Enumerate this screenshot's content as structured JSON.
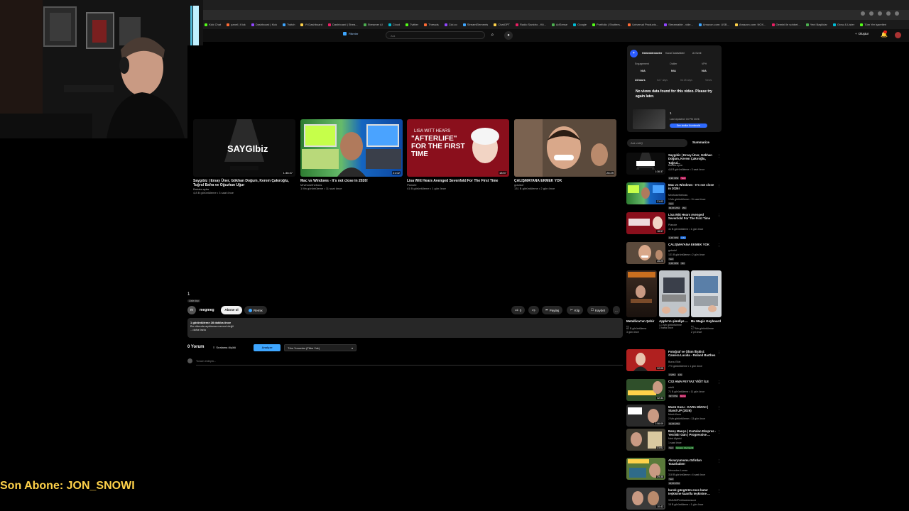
{
  "browser": {
    "bookmarks": [
      "Kick Chat",
      "panel | Kick",
      "Dashboard | Kick",
      "Twitch",
      "Yt Dashboard",
      "Dashboard | Strea...",
      "Streamer AI",
      "Cloud",
      "Twitter",
      "Threads",
      "Cici.co",
      "StreamElements",
      "ChatGPT",
      "Radio Sanidro - Kit...",
      "AdSense",
      "Google",
      "Portfolio | Shutters...",
      "Universal Products...",
      "Streamable - vide...",
      "Amazon.com: USB...",
      "Amazon.com: NOX...",
      "Gemini ile sohbet...",
      "Yeni Başlıklar",
      "Grow & Lister",
      "Tüm Yer işaretleri"
    ]
  },
  "header": {
    "filter_label": "Filtreler",
    "search_placeholder": "Ara",
    "create_label": "Oluştur",
    "notification_count": "9+"
  },
  "end_cards": [
    {
      "title": "Saygıbiz | Ersay Üner, Gökhan Doğum, Kerem Çakıroğlu, Tuğrul Bafra ve Oğuzhan Uğur",
      "channel": "Babala.ayka",
      "meta": "4,8 B görüntüleme • 3 saat önce",
      "duration": "1:36:37",
      "thumb_text": "SAYGIbiz"
    },
    {
      "title": "Mac vs Windows - It's not close in 2026!",
      "channel": "Mrwhosetheboss",
      "meta": "1 Mn görüntüleme • 11 saat önce",
      "duration": "21:02"
    },
    {
      "title": "Lisa Witt Hears Avenged Sevenfold For The First Time",
      "channel": "Pianote",
      "meta": "41 B görüntüleme • 1 gün önce",
      "duration": "18:57",
      "thumb_text": "\"AFTERLIFE\" FOR THE FIRST TIME",
      "thumb_top": "LISA WITT HEARS"
    },
    {
      "title": "ÇALIŞMAYANA EKMEK YOK",
      "channel": "gokaluf",
      "meta": "131 B görüntüleme • 2 gün önce",
      "duration": "26:29"
    }
  ],
  "video": {
    "title": "1",
    "tag": "Liste dışı",
    "channel_initial": "m",
    "channel": "megmeg",
    "subscribe_label": "Abone ol",
    "remix_label": "Remix",
    "likes": "0",
    "share_label": "Paylaş",
    "clip_label": "Klip",
    "save_label": "Kaydet",
    "more_label": "...",
    "description_stats": "1 görüntüleme  28 dakika önce",
    "description_text": "Bu videoda açıklama mevcut değil",
    "description_more": "...daha fazla",
    "comments_count": "0 Yorum",
    "sort_label": "Sıralama ölçütü",
    "analyze_label": "Analyze",
    "comment_filter": "Tüm Yorumlar (Filtre Yok)",
    "comment_placeholder": "Yorum ekleyin..."
  },
  "extension": {
    "tabs": [
      "Görüntülenmeler",
      "Kanal İstatistikleri",
      "AI Özeti"
    ],
    "headers": [
      "Engagement",
      "Outlier",
      "VPH"
    ],
    "values": [
      "N/A",
      "N/A",
      "N/A"
    ],
    "ranges": [
      "24 hours",
      "Ist 7 days",
      "Ist 28 days",
      "Views"
    ],
    "message": "No views data found for this video. Please try again later.",
    "rank": "1",
    "updated": "Last Updated: 04 PM 2026",
    "similar_label": "See similar thumbnails"
  },
  "ask": {
    "placeholder": "Ask vidIQ",
    "summarize_label": "Summarize"
  },
  "recommendations": [
    {
      "title": "Saygıbiz | Ersay Üner, Gökhan Doğum, Kerem Çakıroğlu, Tuğrul...",
      "channel": "Babala.ayka",
      "meta": "4,8 B görüntüleme • 3 saat önce",
      "duration": "1:36:37",
      "badges": [
        "1,9K VPH",
        "Yeni"
      ]
    },
    {
      "title": "Mac vs Windows - It's not close in 2026!",
      "channel": "Mrwhosetheboss",
      "meta": "1 Mn görüntüleme • 11 saat önce",
      "duration": "21:02",
      "badges": [
        "Yeni",
        "84,9K VPH",
        "25x"
      ]
    },
    {
      "title": "Lisa Witt Hears Avenged Sevenfold For The First Time",
      "channel": "Pianote",
      "meta": "41 B görüntüleme • 1 gün önce",
      "duration": "18:57",
      "badges": [
        "1,4K VPH",
        "3,6x"
      ]
    },
    {
      "title": "ÇALIŞMAYANA EKMEK YOK",
      "channel": "gokaluf",
      "meta": "131 B görüntüleme • 2 gün önce",
      "duration": "26:29",
      "badges": [
        "Yeni",
        "1,2K VPH",
        "11x"
      ]
    },
    {
      "title": "Fotoğraf ve Ölüm İlişkisi: Camera Lucida - Roland Barthes",
      "channel": "Burcu Ekin",
      "meta": "770 görüntüleme • 1 gün önce",
      "duration": "22:05",
      "badges": [
        "4 VPH",
        "1,8x"
      ]
    },
    {
      "title": "CS2 AMA FEYYAZ YİĞİT İLE",
      "channel": "wtcN",
      "meta": "71 B görüntüleme • 11 gün önce",
      "duration": "32:34",
      "badges": [
        "637 VPH",
        "63,1x"
      ]
    },
    {
      "title": "Mustı Kuzu - KARA MİZAH | Stand UP (2026)",
      "channel": "Mustı Kuzu",
      "meta": "2 Mn görüntüleme • 13 gün önce",
      "duration": "1:06:09",
      "badges": [
        "12,6K VPH"
      ]
    },
    {
      "title": "Barış Manço | Kurtalan Ekspres - Yeni Bir Gün | Progressive ...",
      "channel": "Mert Alpteki",
      "meta": "1 saat önce",
      "duration": "21:02",
      "badges": [
        "Yeni",
        "Üyelere özel içerik"
      ]
    },
    {
      "title": "Akvaryumumu Sıfırdan Tasarladım!",
      "channel": "Mercedes Lomar",
      "meta": "318 B görüntüleme • 4 saat önce",
      "duration": "29:38",
      "badges": [
        "Yeni",
        "22,9K VPH"
      ]
    },
    {
      "title": "bursk güngörün enes batur teşkisine kaanfla teşkisine ...",
      "channel": "SAKAMPLülüsahamsoni",
      "meta": "15 B görüntüleme • 1 gün önce",
      "duration": "10:42",
      "badges": []
    }
  ],
  "shorts": [
    {
      "title": "Metallica'nın Şehir ...",
      "meta": "62 B görüntüleme",
      "sub": "3 gün önce"
    },
    {
      "title": "Apple'ın şimdiye ...",
      "meta": "1,1 Mn görüntüleme",
      "sub": "3 hafta önce"
    },
    {
      "title": "Bu Magic Keyboard ...",
      "meta": "4,7 Mn görüntüleme",
      "sub": "2 yıl önce"
    }
  ],
  "overlay": {
    "son_abone": "Son Abone: JON_SNOWI"
  },
  "colors": {
    "accent": "#3ea6ff",
    "overlay_text": "#ffd24a",
    "background": "#0f0f0f"
  }
}
